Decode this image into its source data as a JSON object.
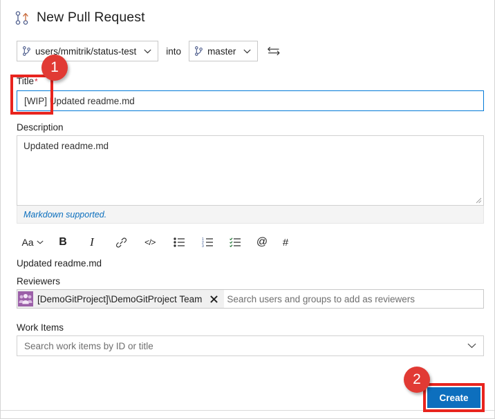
{
  "page": {
    "title": "New Pull Request",
    "title_icon": "pull-request-icon"
  },
  "branches": {
    "source": {
      "value": "users/mmitrik/status-test",
      "icon": "branch-icon",
      "chevron": "chevron-down-icon"
    },
    "into_label": "into",
    "target": {
      "value": "master",
      "icon": "branch-icon",
      "chevron": "chevron-down-icon"
    },
    "swap_icon": "swap-branches-icon"
  },
  "title_field": {
    "label": "Title",
    "required_marker": "*",
    "value": "[WIP] Updated readme.md",
    "highlight_color": "#e8241e",
    "focus_border_color": "#0078d7"
  },
  "description_field": {
    "label": "Description",
    "value": "Updated readme.md",
    "footer_note": "Markdown supported.",
    "footer_note_color": "#0a6ebd",
    "resize_handle": "resize-grip-icon"
  },
  "markdown_toolbar": {
    "items": [
      {
        "name": "font-size-icon",
        "label": "Aa"
      },
      {
        "name": "bold-icon",
        "label": "B"
      },
      {
        "name": "italic-icon",
        "label": "I"
      },
      {
        "name": "link-icon",
        "label": ""
      },
      {
        "name": "code-icon",
        "label": "</>"
      },
      {
        "name": "bulleted-list-icon",
        "label": ""
      },
      {
        "name": "numbered-list-icon",
        "label": ""
      },
      {
        "name": "task-list-icon",
        "label": ""
      },
      {
        "name": "mention-icon",
        "label": "@"
      },
      {
        "name": "hash-icon",
        "label": "#"
      }
    ]
  },
  "preview": {
    "text": "Updated readme.md"
  },
  "reviewers_field": {
    "label": "Reviewers",
    "chip": {
      "label": "[DemoGitProject]\\DemoGitProject Team",
      "avatar": "group-avatar-icon",
      "avatar_color": "#9b5fa8",
      "remove_icon": "close-icon"
    },
    "placeholder": "Search users and groups to add as reviewers"
  },
  "work_items_field": {
    "label": "Work Items",
    "placeholder": "Search work items by ID or title",
    "chevron": "chevron-down-icon"
  },
  "actions": {
    "create_label": "Create",
    "create_color": "#0d6fbe",
    "highlight_color": "#e8241e"
  },
  "annotations": {
    "badge_color": "#e13a34",
    "steps": [
      {
        "number": "1",
        "target": "title-field"
      },
      {
        "number": "2",
        "target": "create-button"
      }
    ]
  }
}
